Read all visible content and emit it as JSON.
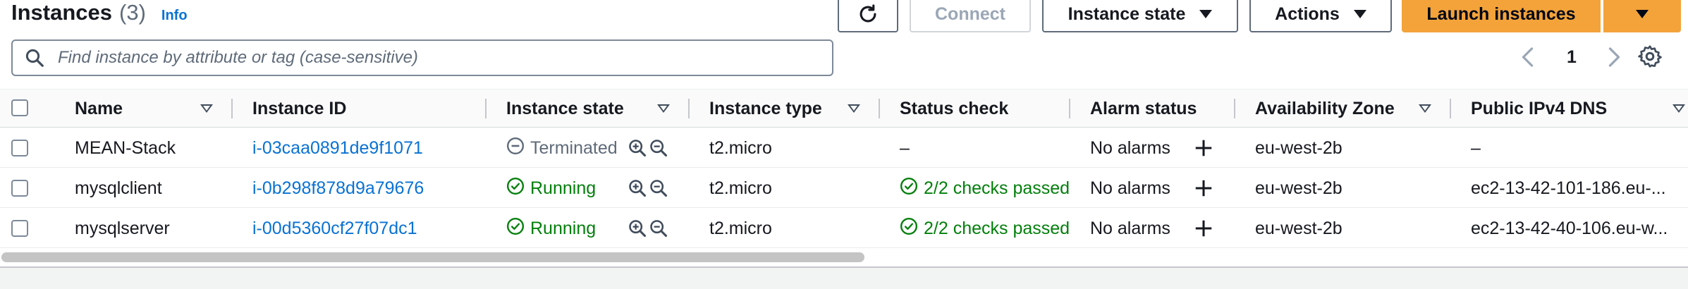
{
  "header": {
    "title": "Instances",
    "count": "(3)",
    "info_label": "Info"
  },
  "toolbar": {
    "refresh_icon": "refresh-icon",
    "connect_label": "Connect",
    "instance_state_label": "Instance state",
    "actions_label": "Actions",
    "launch_label": "Launch instances"
  },
  "search": {
    "placeholder": "Find instance by attribute or tag (case-sensitive)",
    "value": ""
  },
  "pagination": {
    "current_page": "1"
  },
  "table": {
    "columns": [
      {
        "label": "Name",
        "sortable": true
      },
      {
        "label": "Instance ID",
        "sortable": false
      },
      {
        "label": "Instance state",
        "sortable": true
      },
      {
        "label": "Instance type",
        "sortable": true
      },
      {
        "label": "Status check",
        "sortable": false
      },
      {
        "label": "Alarm status",
        "sortable": false
      },
      {
        "label": "Availability Zone",
        "sortable": true
      },
      {
        "label": "Public IPv4 DNS",
        "sortable": true
      }
    ],
    "rows": [
      {
        "name": "MEAN-Stack",
        "instance_id": "i-03caa0891de9f1071",
        "state": "Terminated",
        "state_kind": "terminated",
        "type": "t2.micro",
        "status_check": "–",
        "status_kind": "none",
        "alarm_status": "No alarms",
        "az": "eu-west-2b",
        "dns": "–"
      },
      {
        "name": "mysqlclient",
        "instance_id": "i-0b298f878d9a79676",
        "state": "Running",
        "state_kind": "running",
        "type": "t2.micro",
        "status_check": "2/2 checks passed",
        "status_kind": "passed",
        "alarm_status": "No alarms",
        "az": "eu-west-2b",
        "dns": "ec2-13-42-101-186.eu-..."
      },
      {
        "name": "mysqlserver",
        "instance_id": "i-00d5360cf27f07dc1",
        "state": "Running",
        "state_kind": "running",
        "type": "t2.micro",
        "status_check": "2/2 checks passed",
        "status_kind": "passed",
        "alarm_status": "No alarms",
        "az": "eu-west-2b",
        "dns": "ec2-13-42-40-106.eu-w..."
      }
    ]
  },
  "colors": {
    "accent_link": "#0972d3",
    "primary_button": "#f3a33a",
    "success": "#037f0c",
    "muted": "#5f6b7a"
  }
}
